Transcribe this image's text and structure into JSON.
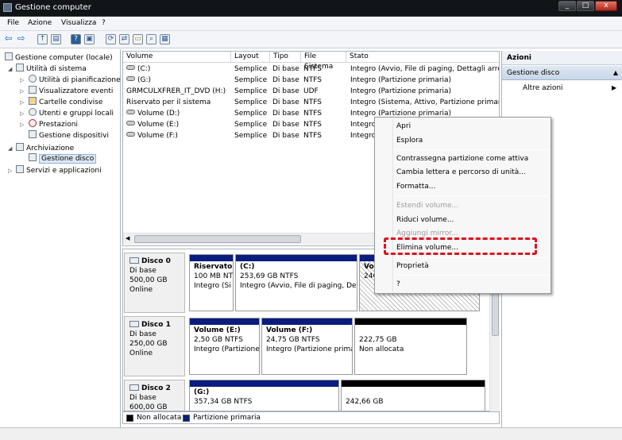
{
  "window": {
    "title": "Gestione computer",
    "controls": [
      "_",
      "□",
      "x"
    ]
  },
  "menu": [
    "File",
    "Azione",
    "Visualizza",
    "?"
  ],
  "tree": {
    "root": "Gestione computer (locale)",
    "utilities": "Utilità di sistema",
    "scheduler": "Utilità di pianificazione",
    "events": "Visualizzatore eventi",
    "shares": "Cartelle condivise",
    "users": "Utenti e gruppi locali",
    "perf": "Prestazioni",
    "devmgr": "Gestione dispositivi",
    "storage": "Archiviazione",
    "diskmgmt": "Gestione disco",
    "services": "Servizi e applicazioni"
  },
  "volume_list": {
    "headers": [
      "Volume",
      "Layout",
      "Tipo",
      "File Sistema",
      "Stato"
    ],
    "rows": [
      [
        "(C:)",
        "Semplice",
        "Di base",
        "NTFS",
        "Integro (Avvio, File di paging, Dettagli arresto"
      ],
      [
        "(G:)",
        "Semplice",
        "Di base",
        "NTFS",
        "Integro (Partizione primaria)"
      ],
      [
        "GRMCULXFRER_IT_DVD (H:)",
        "Semplice",
        "Di base",
        "UDF",
        "Integro (Partizione primaria)"
      ],
      [
        "Riservato per il sistema",
        "Semplice",
        "Di base",
        "NTFS",
        "Integro (Sistema, Attivo, Partizione primaria)"
      ],
      [
        "Volume (D:)",
        "Semplice",
        "Di base",
        "NTFS",
        "Integro (Partizione primaria)"
      ],
      [
        "Volume (E:)",
        "Semplice",
        "Di base",
        "NTFS",
        "Integro"
      ],
      [
        "Volume (F:)",
        "Semplice",
        "Di base",
        "NTFS",
        "Integro"
      ]
    ]
  },
  "disks": {
    "d0": {
      "name": "Disco 0",
      "type": "Di base",
      "size": "500,00 GB",
      "status": "Online",
      "p1": {
        "name": "Riservato",
        "size": "100 MB NTI",
        "status": "Integro (Si"
      },
      "p2": {
        "name": "(C:)",
        "size": "253,69 GB NTFS",
        "status": "Integro (Avvio, File di paging, Dett"
      },
      "p3": {
        "name": "Vol",
        "size": "246"
      }
    },
    "d1": {
      "name": "Disco 1",
      "type": "Di base",
      "size": "250,00 GB",
      "status": "Online",
      "p1": {
        "name": "Volume  (E:)",
        "size": "2,50 GB NTFS",
        "status": "Integro (Partizione"
      },
      "p2": {
        "name": "Volume  (F:)",
        "size": "24,75 GB NTFS",
        "status": "Integro (Partizione prima"
      },
      "p3": {
        "size": "222,75 GB",
        "status": "Non allocata"
      }
    },
    "d2": {
      "name": "Disco 2",
      "type": "Di base",
      "size": "600,00 GB",
      "p1": {
        "name": "(G:)",
        "size": "357,34 GB NTFS"
      },
      "p2": {
        "size": "242,66 GB"
      }
    }
  },
  "legend": {
    "unalloc": "Non allocata",
    "primary": "Partizione primaria"
  },
  "actions": {
    "header": "Azioni",
    "section": "Gestione disco",
    "more": "Altre azioni"
  },
  "context_menu": {
    "open": "Apri",
    "explore": "Esplora",
    "mark_active": "Contrassegna partizione come attiva",
    "change_letter": "Cambia lettera e percorso di unità...",
    "format": "Formatta...",
    "extend": "Estendi volume...",
    "shrink": "Riduci volume...",
    "mirror": "Aggiungi mirror...",
    "delete": "Elimina volume...",
    "properties": "Proprietà",
    "help": "?"
  },
  "colors": {
    "primary_partition": "#0a1c7e",
    "unallocated": "#000000",
    "highlight": "#e0101e",
    "titlebar": "#111418"
  }
}
